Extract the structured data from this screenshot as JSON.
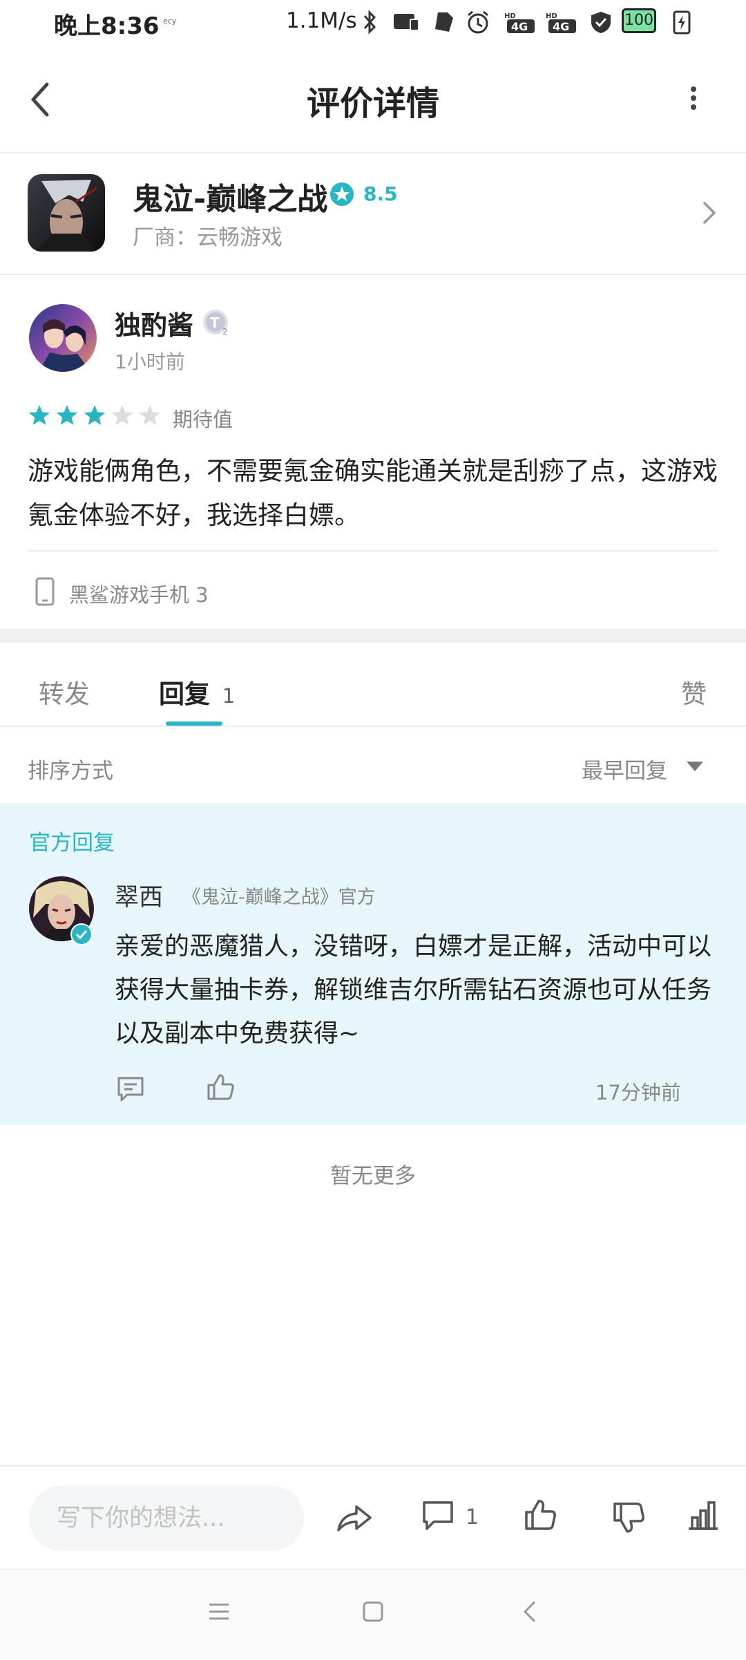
{
  "status_bar": {
    "time": "晚上8:36",
    "speed": "1.1M/s",
    "battery": "100"
  },
  "header": {
    "title": "评价详情"
  },
  "game": {
    "name": "鬼泣-巅峰之战",
    "score": "8.5",
    "vendor": "厂商：云畅游戏"
  },
  "review": {
    "author": "独酌酱",
    "time": "1小时前",
    "rating": 3,
    "rating_max": 5,
    "rating_label": "期待值",
    "text": "游戏能俩角色，不需要氪金确实能通关就是刮痧了点，这游戏氪金体验不好，我选择白嫖。",
    "device": "黑鲨游戏手机 3"
  },
  "tabs": {
    "forward": "转发",
    "reply": "回复",
    "reply_count": "1",
    "like": "赞"
  },
  "sort": {
    "label": "排序方式",
    "value": "最早回复"
  },
  "official_reply": {
    "section_label": "官方回复",
    "name": "翠西",
    "source": "《鬼泣-巅峰之战》官方",
    "text": "亲爱的恶魔猎人，没错呀，白嫖才是正解，活动中可以获得大量抽卡券，解锁维吉尔所需钻石资源也可从任务以及副本中免费获得~",
    "time": "17分钟前"
  },
  "no_more": "暂无更多",
  "bottom_bar": {
    "placeholder": "写下你的想法...",
    "comment_count": "1"
  },
  "colors": {
    "accent": "#2ab5c3",
    "star_empty": "#dddddd",
    "official_bg": "#e6f6f9"
  }
}
